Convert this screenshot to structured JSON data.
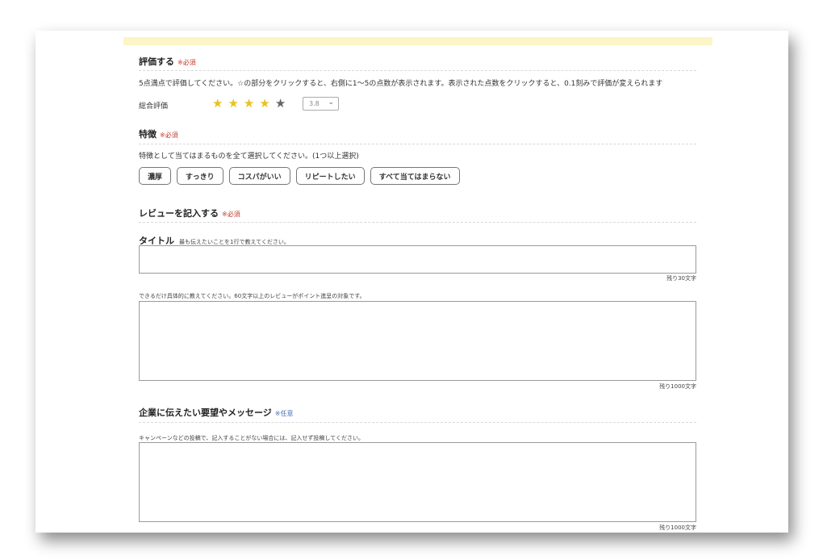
{
  "rating": {
    "title": "評価する",
    "required": "※必須",
    "description": "5点満点で評価してください。☆の部分をクリックすると、右側に1〜5の点数が表示されます。表示された点数をクリックすると、0.1刻みで評価が変えられます",
    "overall_label": "総合評価",
    "stars_filled": 4,
    "stars_total": 5,
    "score_value": "3.8"
  },
  "features": {
    "title": "特徴",
    "required": "※必須",
    "description": "特徴として当てはまるものを全て選択してください。(1つ以上選択)",
    "options": [
      "濃厚",
      "すっきり",
      "コスパがいい",
      "リピートしたい",
      "すべて当てはまらない"
    ]
  },
  "review": {
    "title": "レビューを記入する",
    "required": "※必須",
    "title_label": "タイトル",
    "title_hint": "最も伝えたいことを1行で教えてください。",
    "title_counter": "残り30文字",
    "body_hint": "できるだけ具体的に教えてください。60文字以上のレビューがポイント進呈の対象です。",
    "body_counter": "残り1000文字"
  },
  "message": {
    "title": "企業に伝えたい要望やメッセージ",
    "optional": "※任意",
    "hint": "キャンペーンなどの投稿で、記入することがない場合には、記入せず投稿してください。",
    "counter": "残り1000文字"
  },
  "colors": {
    "star_on": "#e8c31d",
    "star_off": "#666666",
    "required": "#c0392b",
    "optional": "#4a6fb5",
    "top_band": "#fcf5c5"
  }
}
